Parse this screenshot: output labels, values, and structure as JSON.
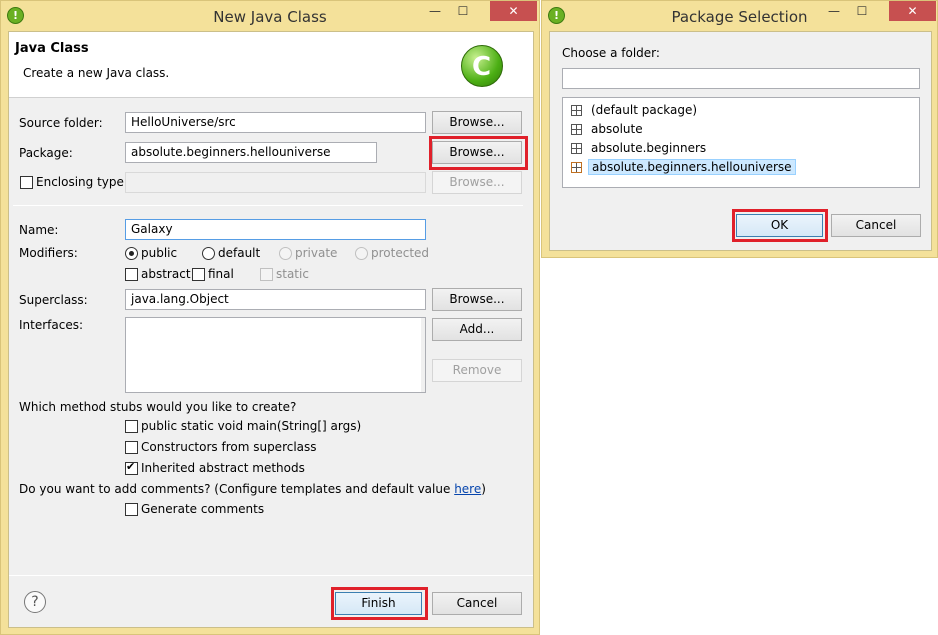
{
  "dialog": {
    "window_title": "New Java Class",
    "minimize": "—",
    "maximize": "☐",
    "close": "✕",
    "header_title": "Java Class",
    "header_subtitle": "Create a new Java class.",
    "source_folder": {
      "label": "Source folder:",
      "value": "HelloUniverse/src",
      "browse": "Browse..."
    },
    "package": {
      "label": "Package:",
      "value": "absolute.beginners.hellouniverse",
      "browse": "Browse..."
    },
    "enclosing": {
      "label": "Enclosing type:",
      "value": "",
      "browse": "Browse...",
      "checked": false
    },
    "name": {
      "label": "Name:",
      "value": "Galaxy"
    },
    "modifiers": {
      "label": "Modifiers:",
      "public": "public",
      "default": "default",
      "private": "private",
      "protected": "protected",
      "abstract": "abstract",
      "final": "final",
      "static": "static"
    },
    "superclass": {
      "label": "Superclass:",
      "value": "java.lang.Object",
      "browse": "Browse..."
    },
    "interfaces": {
      "label": "Interfaces:",
      "add": "Add...",
      "remove": "Remove"
    },
    "stubs": {
      "question": "Which method stubs would you like to create?",
      "main": "public static void main(String[] args)",
      "constructors": "Constructors from superclass",
      "inherited": "Inherited abstract methods"
    },
    "comments": {
      "question_pre": "Do you want to add comments? (Configure templates and default value ",
      "link": "here",
      "question_post": ")",
      "generate": "Generate comments"
    },
    "help": "?",
    "finish": "Finish",
    "cancel": "Cancel"
  },
  "package_dialog": {
    "window_title": "Package Selection",
    "minimize": "—",
    "maximize": "☐",
    "close": "✕",
    "prompt": "Choose a folder:",
    "filter_value": "",
    "items": [
      {
        "label": "(default package)"
      },
      {
        "label": "absolute"
      },
      {
        "label": "absolute.beginners"
      },
      {
        "label": "absolute.beginners.hellouniverse"
      }
    ],
    "ok": "OK",
    "cancel": "Cancel"
  },
  "colors": {
    "highlight": "#e0202a",
    "window_frame": "#f4e19a",
    "close_button": "#c75050",
    "selection": "#cce8ff"
  }
}
